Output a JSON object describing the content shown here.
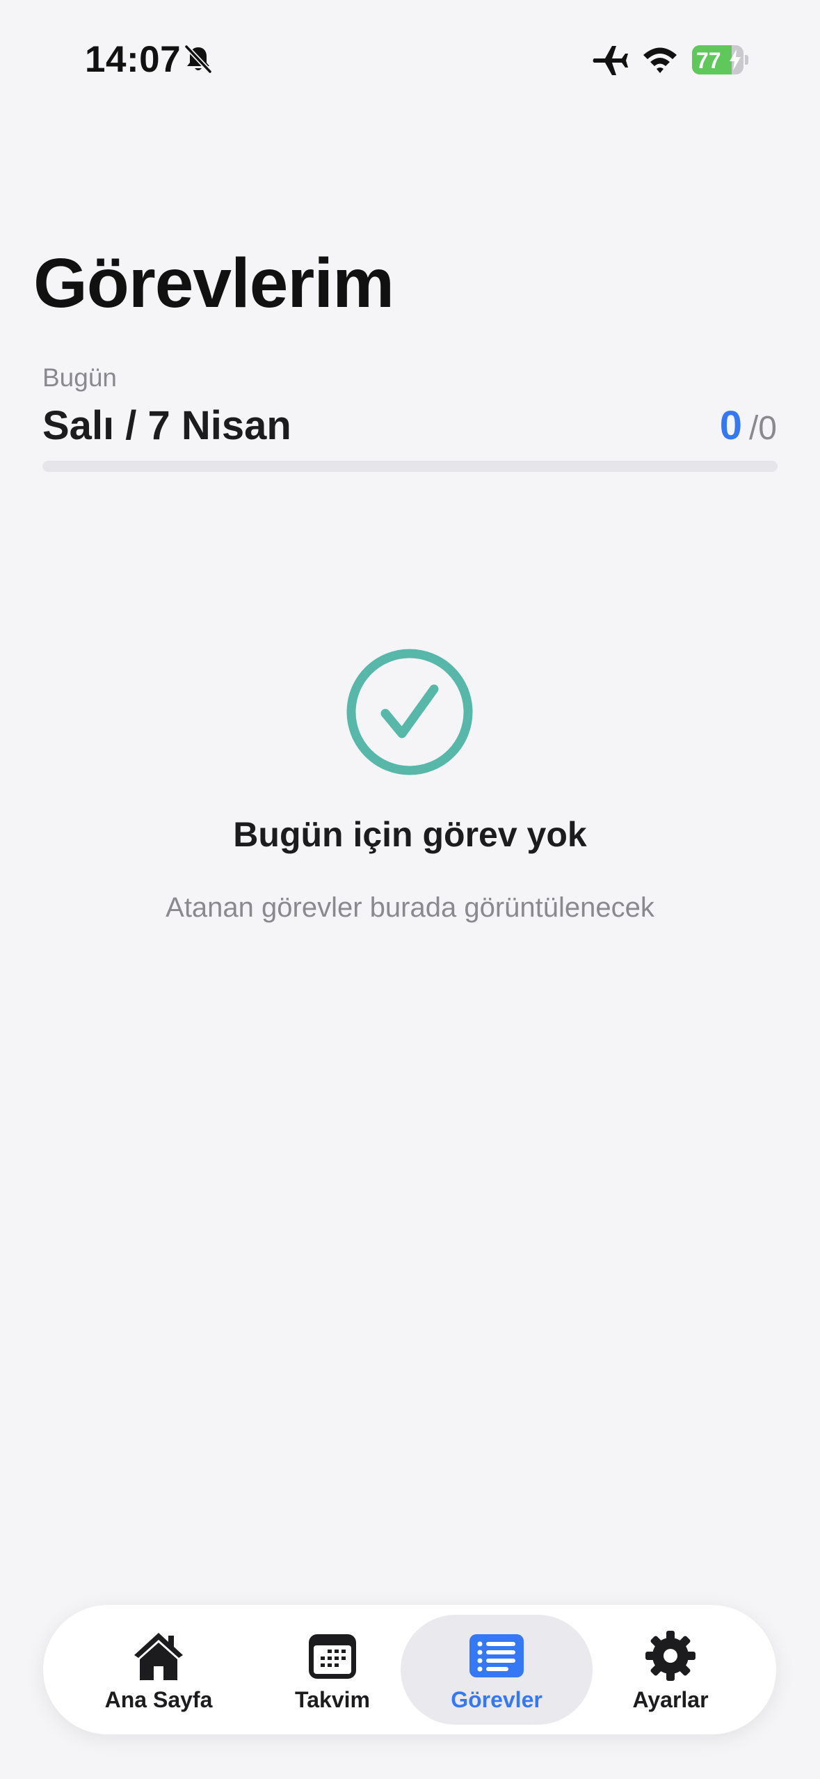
{
  "status_bar": {
    "time": "14:07",
    "battery_level": 77,
    "battery_text": "77",
    "icons": [
      "bell-slash-icon",
      "airplane-icon",
      "wifi-icon",
      "battery-charging-icon"
    ]
  },
  "header": {
    "title": "Görevlerim",
    "today_label": "Bugün",
    "date": "Salı / 7 Nisan",
    "tasks_done": "0",
    "tasks_total": "/0",
    "progress": 0
  },
  "empty_state": {
    "icon": "check-circle-icon",
    "title": "Bugün için görev yok",
    "subtitle": "Atanan görevler burada görüntülenecek"
  },
  "tab_bar": {
    "active": "Görevler",
    "items": [
      {
        "label": "Ana Sayfa",
        "icon": "home-icon"
      },
      {
        "label": "Takvim",
        "icon": "calendar-icon"
      },
      {
        "label": "Görevler",
        "icon": "list-icon"
      },
      {
        "label": "Ayarlar",
        "icon": "gear-icon"
      }
    ]
  },
  "colors": {
    "accent": "#3478f6",
    "check": "#57b8aa",
    "battery_green": "#5fc85b",
    "background": "#f5f5f7"
  }
}
